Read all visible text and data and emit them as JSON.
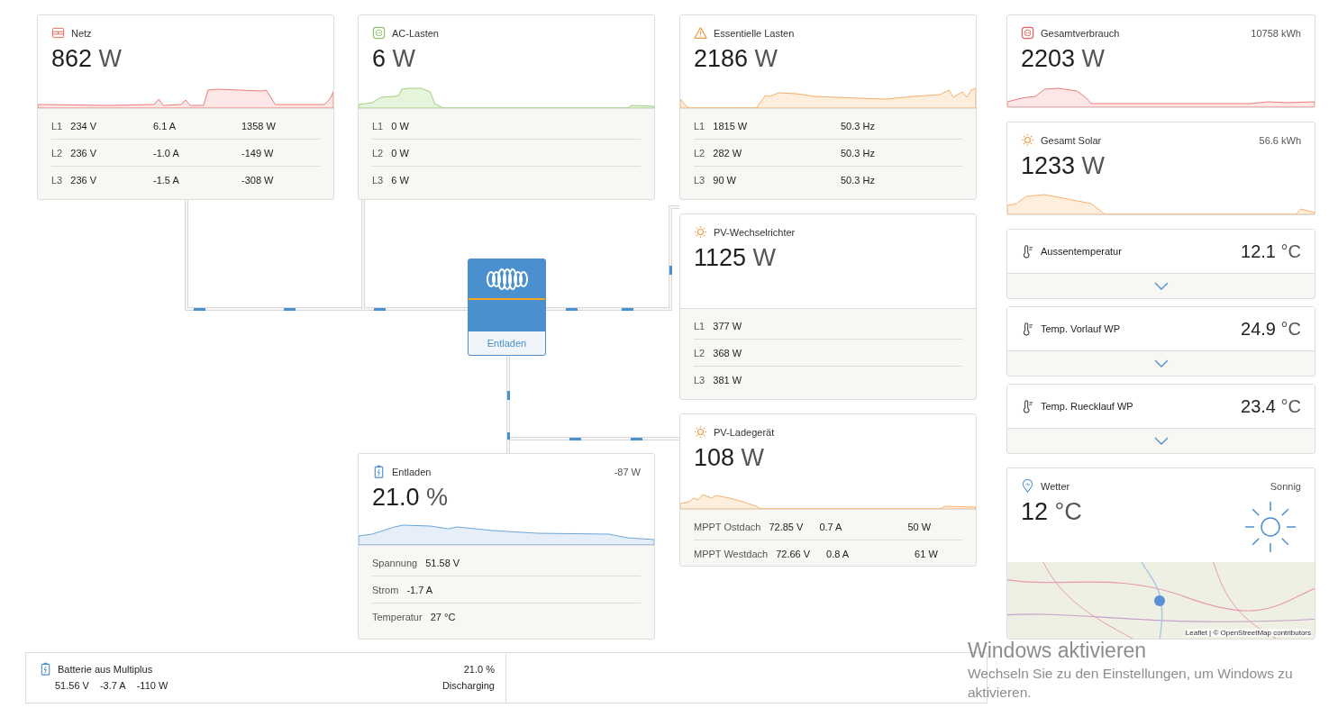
{
  "cards": [
    {
      "kind": "grid",
      "title": "Netz",
      "value": "862",
      "unit": "W",
      "rows": [
        {
          "label": "L1",
          "values": [
            "234 V",
            "6.1 A",
            "1358 W"
          ]
        },
        {
          "label": "L2",
          "values": [
            "236 V",
            "-1.0 A",
            "-149 W"
          ]
        },
        {
          "label": "L3",
          "values": [
            "236 V",
            "-1.5 A",
            "-308 W"
          ]
        }
      ]
    },
    {
      "kind": "socket",
      "title": "AC-Lasten",
      "value": "6",
      "unit": "W",
      "rows": [
        {
          "label": "L1",
          "values": [
            "0 W"
          ]
        },
        {
          "label": "L2",
          "values": [
            "0 W"
          ]
        },
        {
          "label": "L3",
          "values": [
            "6 W"
          ]
        }
      ]
    },
    {
      "kind": "warning",
      "title": "Essentielle Lasten",
      "value": "2186",
      "unit": "W",
      "rows": [
        {
          "label": "L1",
          "values": [
            "1815 W",
            "50.3 Hz"
          ]
        },
        {
          "label": "L2",
          "values": [
            "282 W",
            "50.3 Hz"
          ]
        },
        {
          "label": "L3",
          "values": [
            "90 W",
            "50.3 Hz"
          ]
        }
      ]
    },
    {
      "kind": "sun",
      "title": "PV-Wechselrichter",
      "value": "1125",
      "unit": "W",
      "rows": [
        {
          "label": "L1",
          "values": [
            "377 W"
          ]
        },
        {
          "label": "L2",
          "values": [
            "368 W"
          ]
        },
        {
          "label": "L3",
          "values": [
            "381 W"
          ]
        }
      ]
    },
    {
      "kind": "sun",
      "title": "PV-Ladegerät",
      "value": "108",
      "unit": "W",
      "rows": [
        {
          "label": "MPPT Ostdach",
          "values": [
            "72.85 V",
            "0.7 A",
            "50 W"
          ]
        },
        {
          "label": "MPPT Westdach",
          "values": [
            "72.66 V",
            "0.8 A",
            "61 W"
          ]
        }
      ]
    },
    {
      "kind": "battery",
      "title": "Entladen",
      "side": "-87 W",
      "value": "21.0",
      "unit": "%",
      "rows": [
        {
          "label": "Spannung",
          "values": [
            "51.58 V"
          ]
        },
        {
          "label": "Strom",
          "values": [
            "-1.7 A"
          ]
        },
        {
          "label": "Temperatur",
          "values": [
            "27 °C"
          ]
        }
      ]
    }
  ],
  "inverter": {
    "label": "Entladen"
  },
  "totals": [
    {
      "kind": "consumption",
      "title": "Gesamtverbrauch",
      "side": "10758 kWh",
      "value": "2203",
      "unit": "W"
    },
    {
      "kind": "sun",
      "title": "Gesamt Solar",
      "side": "56.6 kWh",
      "value": "1233",
      "unit": "W"
    }
  ],
  "temperatures": [
    {
      "title": "Aussentemperatur",
      "value": "12.1",
      "unit": "°C"
    },
    {
      "title": "Temp. Vorlauf WP",
      "value": "24.9",
      "unit": "°C"
    },
    {
      "title": "Temp. Ruecklauf WP",
      "value": "23.4",
      "unit": "°C"
    }
  ],
  "weather": {
    "title": "Wetter",
    "condition": "Sonnig",
    "value": "12",
    "unit": "°C",
    "attribution": "Leaflet | © OpenStreetMap contributors"
  },
  "battery_summary": {
    "title": "Batterie aus Multiplus",
    "soc": "21.0 %",
    "values": [
      "51.56 V",
      "-3.7 A",
      "-110 W"
    ],
    "state": "Discharging"
  },
  "os_overlay": {
    "title": "Windows aktivieren",
    "lines": [
      "Wechseln Sie zu den Einstellungen, um Windows zu",
      "aktivieren."
    ]
  }
}
